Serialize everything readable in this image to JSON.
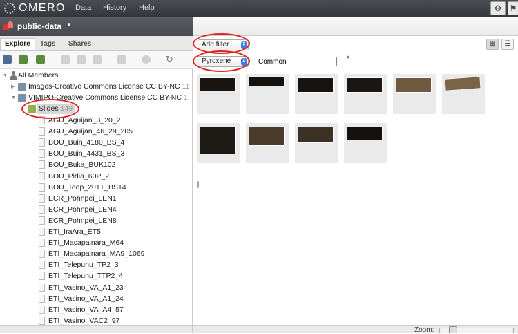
{
  "app": {
    "logo_text": "OMERO"
  },
  "topnav": {
    "items": [
      "Data",
      "History",
      "Help"
    ]
  },
  "group": {
    "name": "public-data"
  },
  "tabs": [
    "Explore",
    "Tags",
    "Shares"
  ],
  "tree": {
    "root": "All Members",
    "projects": [
      {
        "name": "Images-Creative Commons License CC BY-NC",
        "count": "11"
      },
      {
        "name": "VIMIPO-Creative Commons License CC BY-NC",
        "count": "1"
      }
    ],
    "dataset": {
      "name": "Slides",
      "count": "149"
    },
    "images": [
      "AGU_Aguijan_3_20_2",
      "AGU_Aguijan_46_29_205",
      "BOU_Buin_4180_BS_4",
      "BOU_Buin_4431_BS_3",
      "BOU_Buka_BUK102",
      "BOU_Pidia_60P_2",
      "BOU_Teop_201T_BS14",
      "ECR_Pohnpei_LEN1",
      "ECR_Pohnpei_LEN4",
      "ECR_Pohnpei_LEN8",
      "ETI_IraAra_ET5",
      "ETI_Macapainara_M64",
      "ETI_Macapainara_MA9_1069",
      "ETI_Telepunu_TP2_3",
      "ETI_Telepunu_TTP2_4",
      "ETI_Vasino_VA_A1_23",
      "ETI_Vasino_VA_A1_24",
      "ETI_Vasino_VA_A4_57",
      "ETI_Vasino_VAC2_97"
    ]
  },
  "filter": {
    "add_filter_label": "Add filter",
    "key_label": "Pyroxene",
    "value": "Common",
    "clear_label": "X"
  },
  "statusbar": {
    "zoom_label": "Zoom:"
  },
  "colors": {
    "annotation_ring": "#dd2222",
    "topbar": "#3a3d41"
  }
}
